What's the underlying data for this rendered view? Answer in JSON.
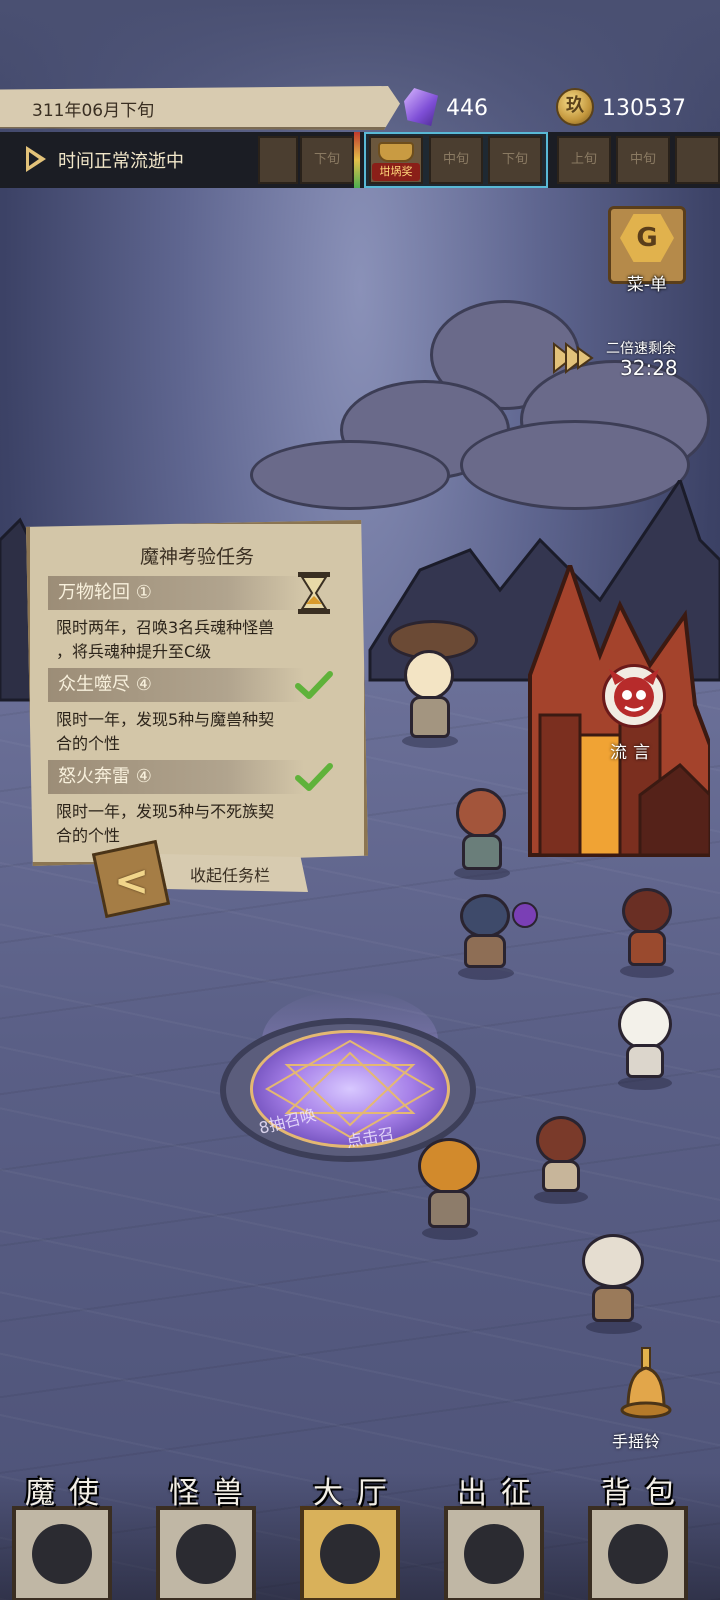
{
  "header": {
    "date": "311年06月下旬",
    "time_status": "时间正常流逝中",
    "gem_count": "446",
    "coin_count": "130537",
    "coin_symbol": "玖"
  },
  "timeline": {
    "slots": [
      "",
      "下旬",
      "",
      "中旬",
      "下旬",
      "上旬",
      "中旬",
      ""
    ],
    "pot_label": "坩埚奖"
  },
  "menu": {
    "label": "菜-单",
    "icon_letter": "G"
  },
  "speed": {
    "label": "二倍速剩余",
    "remaining": "32:28"
  },
  "quest_panel": {
    "title": "魔神考验任务",
    "quests": [
      {
        "name": "万物轮回 ①",
        "desc_line1": "限时两年，召唤3名兵魂种怪兽",
        "desc_line2": "，将兵魂种提升至C级",
        "status": "in-progress"
      },
      {
        "name": "众生噬尽 ④",
        "desc_line1": "限时一年，发现5种与魔兽种契",
        "desc_line2": "合的个性",
        "status": "done"
      },
      {
        "name": "怒火奔雷 ④",
        "desc_line1": "限时一年，发现5种与不死族契",
        "desc_line2": "合的个性",
        "status": "done"
      }
    ],
    "collapse_label": "收起任务栏"
  },
  "rumor": {
    "label": "流言"
  },
  "summon_circle": {
    "text_left": "8抽召唤",
    "text_right": "点击召"
  },
  "bell": {
    "label": "手摇铃"
  },
  "nav": {
    "items": [
      {
        "label": "魔使",
        "active": false
      },
      {
        "label": "怪兽",
        "active": false
      },
      {
        "label": "大厅",
        "active": true
      },
      {
        "label": "出征",
        "active": false
      },
      {
        "label": "背包",
        "active": false
      }
    ]
  },
  "colors": {
    "panel": "#d3c6a8",
    "accent_gold": "#e2c27a",
    "active_slot_border": "#59b9d6",
    "check_green": "#5fb23a"
  }
}
